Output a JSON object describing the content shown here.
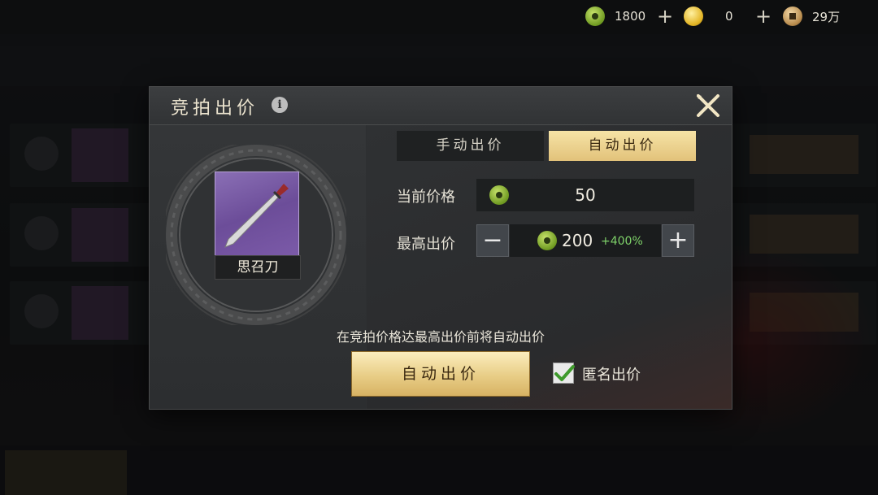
{
  "currency": [
    {
      "icon": "jade-coin-icon",
      "value": "1800"
    },
    {
      "icon": "gold-ingot-icon",
      "value": "0"
    },
    {
      "icon": "copper-coin-icon",
      "value": "29万"
    }
  ],
  "currency_add_label": "+",
  "dialog": {
    "title": "竞拍出价",
    "info_label": "i",
    "item": {
      "name": "思召刀",
      "icon": "saber-icon"
    },
    "tabs": [
      {
        "label": "手动出价",
        "active": false
      },
      {
        "label": "自动出价",
        "active": true
      }
    ],
    "current_price": {
      "label": "当前价格",
      "value": "50"
    },
    "max_bid": {
      "label": "最高出价",
      "value": "200",
      "percent": "+400%",
      "minus_label": "−",
      "plus_label": "+"
    },
    "hint": "在竞拍价格达最高出价前将自动出价",
    "auto_bid_button": "自动出价",
    "anonymous": {
      "label": "匿名出价",
      "checked": true
    }
  },
  "colors": {
    "accent_gold": "#e2c27a",
    "percent_green": "#7fd36a",
    "jade_green": "#8cba2f"
  }
}
